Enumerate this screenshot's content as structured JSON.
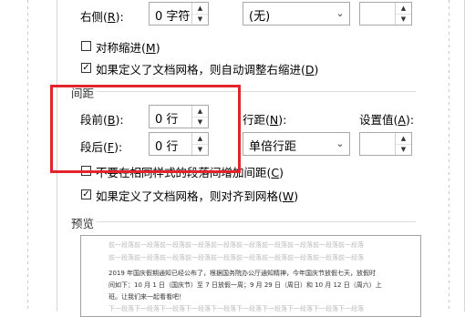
{
  "indent": {
    "right_label": "右侧(",
    "right_key": "R",
    "right_end": "):",
    "right_value": "0 字符",
    "special_value": "(无)",
    "mirror_label": "对称缩进(",
    "mirror_key": "M",
    "mirror_end": ")",
    "mirror_checked": false,
    "auto_adjust_label": "如果定义了文档网格，则自动调整右缩进(",
    "auto_adjust_key": "D",
    "auto_adjust_end": ")",
    "auto_adjust_checked": true
  },
  "spacing": {
    "section_title": "间距",
    "before_label": "段前(",
    "before_key": "B",
    "before_end": "):",
    "before_value": "0 行",
    "after_label": "段后(",
    "after_key": "F",
    "after_end": "):",
    "after_value": "0 行",
    "line_spacing_label": "行距(",
    "line_spacing_key": "N",
    "line_spacing_end": "):",
    "line_spacing_value": "单倍行距",
    "at_label": "设置值(",
    "at_key": "A",
    "at_end": "):",
    "at_value": "",
    "no_space_label": "不要在相同样式的段落间增加间距(",
    "no_space_key": "C",
    "no_space_end": ")",
    "no_space_checked": false,
    "snap_grid_label": "如果定义了文档网格，则对齐到网格(",
    "snap_grid_key": "W",
    "snap_grid_end": ")",
    "snap_grid_checked": true
  },
  "preview": {
    "section_title": "预览",
    "prev_line_1": "前一段落前一段落前一段落前一段落前一段落前一段落前一段落前一段落前一段落前一段落",
    "prev_line_2": "前一段落前一段落前一段落前一段落前一段落前一段落前一段落前一段落前一段落前一段落",
    "body_line_1": "2019 年国庆假期通知已经公布了，根据国务院办公厅通知精神，今年国庆节放假七天，放假时",
    "body_line_2": "间如下：10 月 1 日（国庆节）至 7 日放假一周；9 月 29 日（周日）和 10 月 12 日（周六）上",
    "body_line_3": "班。让我们来一起看看吧！",
    "next_line_1": "下一段落下一段落下一段落下一段落下一段落下一段落下一段落下一段落下一段落下一段落"
  },
  "colors": {
    "highlight": "#e0262a"
  }
}
